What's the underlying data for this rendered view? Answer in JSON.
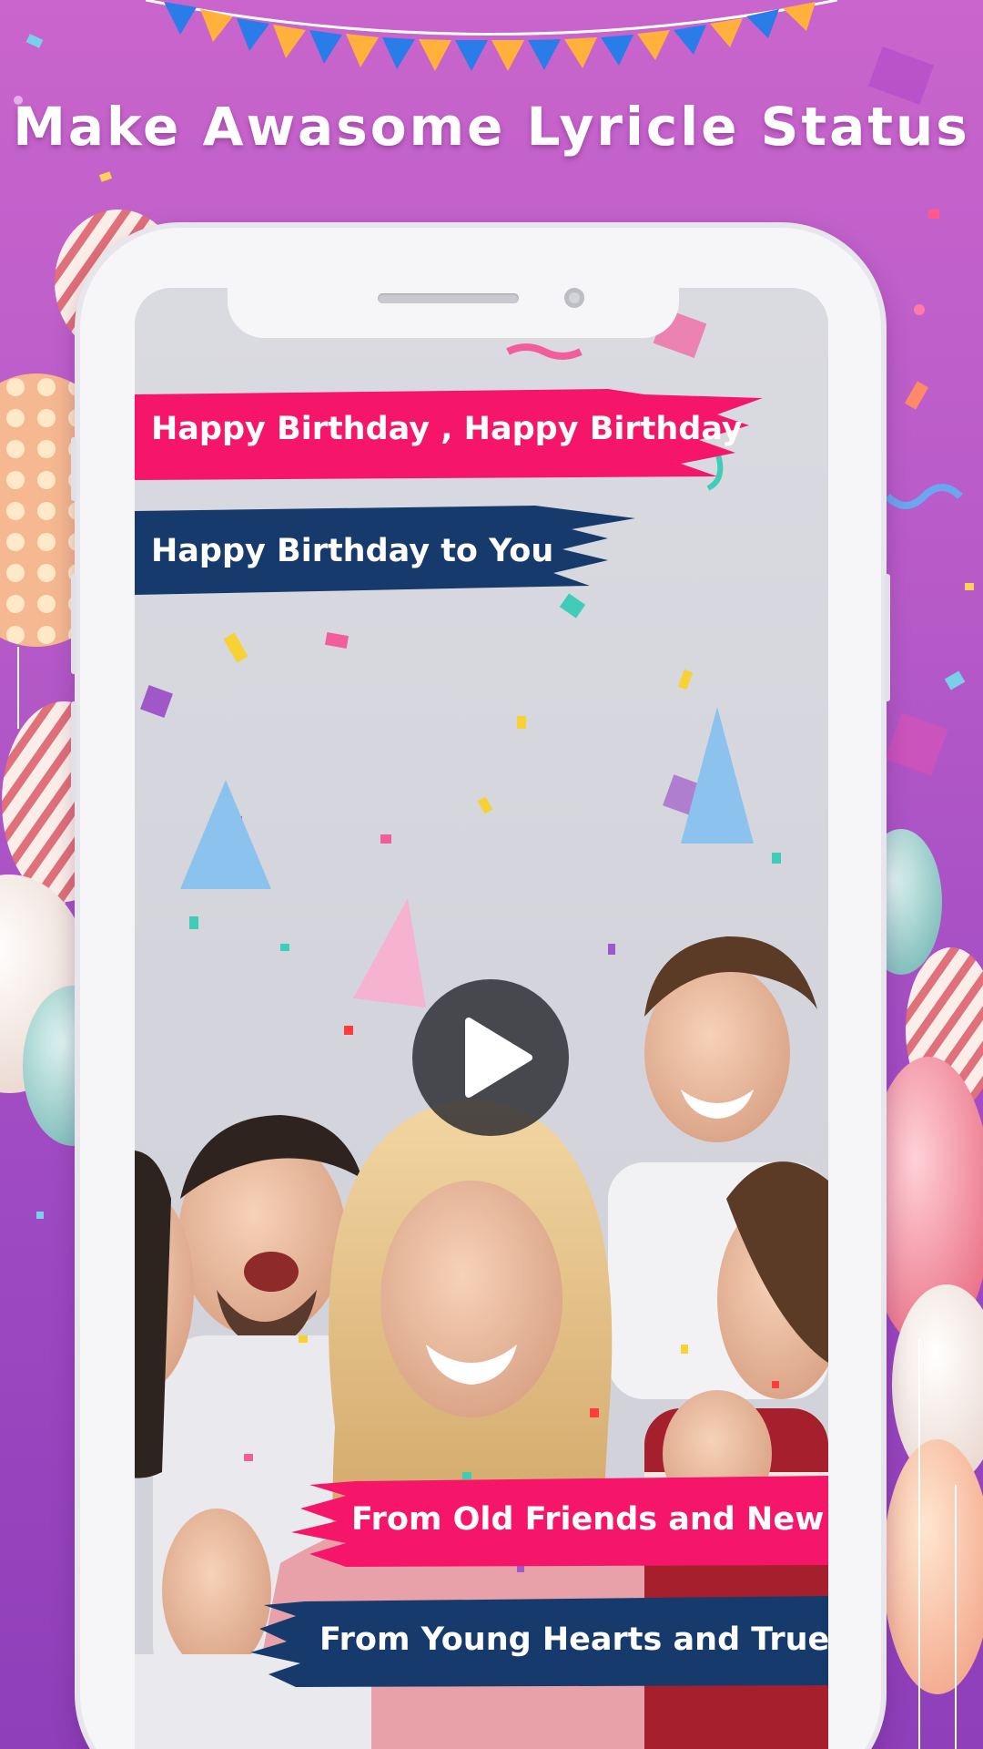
{
  "headline": "Make Awasome Lyricle Status",
  "lyrics": [
    "Happy Birthday , Happy Birthday",
    "Happy Birthday to You",
    "From Old Friends and New",
    "From Young Hearts and True"
  ],
  "colors": {
    "background_top": "#c965cc",
    "background_bottom": "#8e3fb9",
    "lyric_pink": "#f5166a",
    "lyric_navy": "#173a6c",
    "play_button": "#28282e"
  },
  "icons": {
    "play": "play-icon"
  }
}
